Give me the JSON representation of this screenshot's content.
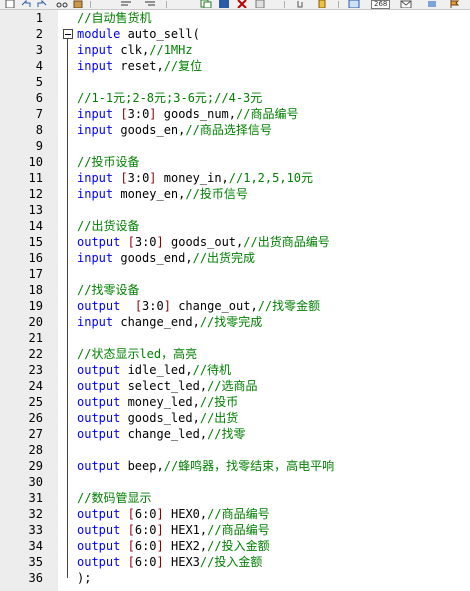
{
  "colors": {
    "keyword": "#0000ff",
    "comment": "#008000",
    "text": "#000000",
    "bracket": "#8b0000",
    "gutter": "#ededed"
  },
  "toolbar": {
    "icons": [
      "new-file",
      "undo",
      "redo",
      "cut",
      "paste",
      "clear",
      "copy",
      "link",
      "bookmark",
      "window",
      "mail"
    ],
    "badge": "268"
  },
  "lines": [
    {
      "n": "1",
      "tokens": [
        [
          "cm",
          "//自动售货机"
        ]
      ]
    },
    {
      "n": "2",
      "fold": true,
      "tokens": [
        [
          "kw",
          "module"
        ],
        [
          "txt",
          " auto_sell("
        ]
      ]
    },
    {
      "n": "3",
      "tokens": [
        [
          "kw",
          "input"
        ],
        [
          "txt",
          " clk,"
        ],
        [
          "cm",
          "//1MHz"
        ]
      ]
    },
    {
      "n": "4",
      "tokens": [
        [
          "kw",
          "input"
        ],
        [
          "txt",
          " reset,"
        ],
        [
          "cm",
          "//复位"
        ]
      ]
    },
    {
      "n": "5",
      "tokens": []
    },
    {
      "n": "6",
      "tokens": [
        [
          "cm",
          "//1-1元;2-8元;3-6元;//4-3元"
        ]
      ]
    },
    {
      "n": "7",
      "tokens": [
        [
          "kw",
          "input"
        ],
        [
          "txt",
          " "
        ],
        [
          "br",
          "["
        ],
        [
          "num",
          "3"
        ],
        [
          "txt",
          ":"
        ],
        [
          "num",
          "0"
        ],
        [
          "br",
          "]"
        ],
        [
          "txt",
          " goods_num,"
        ],
        [
          "cm",
          "//商品编号"
        ]
      ]
    },
    {
      "n": "8",
      "tokens": [
        [
          "kw",
          "input"
        ],
        [
          "txt",
          " goods_en,"
        ],
        [
          "cm",
          "//商品选择信号"
        ]
      ]
    },
    {
      "n": "9",
      "tokens": []
    },
    {
      "n": "10",
      "tokens": [
        [
          "cm",
          "//投币设备"
        ]
      ]
    },
    {
      "n": "11",
      "tokens": [
        [
          "kw",
          "input"
        ],
        [
          "txt",
          " "
        ],
        [
          "br",
          "["
        ],
        [
          "num",
          "3"
        ],
        [
          "txt",
          ":"
        ],
        [
          "num",
          "0"
        ],
        [
          "br",
          "]"
        ],
        [
          "txt",
          " money_in,"
        ],
        [
          "cm",
          "//1,2,5,10元"
        ]
      ]
    },
    {
      "n": "12",
      "tokens": [
        [
          "kw",
          "input"
        ],
        [
          "txt",
          " money_en,"
        ],
        [
          "cm",
          "//投币信号"
        ]
      ]
    },
    {
      "n": "13",
      "tokens": []
    },
    {
      "n": "14",
      "tokens": [
        [
          "cm",
          "//出货设备"
        ]
      ]
    },
    {
      "n": "15",
      "tokens": [
        [
          "kw",
          "output"
        ],
        [
          "txt",
          " "
        ],
        [
          "br",
          "["
        ],
        [
          "num",
          "3"
        ],
        [
          "txt",
          ":"
        ],
        [
          "num",
          "0"
        ],
        [
          "br",
          "]"
        ],
        [
          "txt",
          " goods_out,"
        ],
        [
          "cm",
          "//出货商品编号"
        ]
      ]
    },
    {
      "n": "16",
      "tokens": [
        [
          "kw",
          "input"
        ],
        [
          "txt",
          " goods_end,"
        ],
        [
          "cm",
          "//出货完成"
        ]
      ]
    },
    {
      "n": "17",
      "tokens": []
    },
    {
      "n": "18",
      "tokens": [
        [
          "cm",
          "//找零设备"
        ]
      ]
    },
    {
      "n": "19",
      "tokens": [
        [
          "kw",
          "output"
        ],
        [
          "txt",
          "  "
        ],
        [
          "br",
          "["
        ],
        [
          "num",
          "3"
        ],
        [
          "txt",
          ":"
        ],
        [
          "num",
          "0"
        ],
        [
          "br",
          "]"
        ],
        [
          "txt",
          " change_out,"
        ],
        [
          "cm",
          "//找零金额"
        ]
      ]
    },
    {
      "n": "20",
      "tokens": [
        [
          "kw",
          "input"
        ],
        [
          "txt",
          " change_end,"
        ],
        [
          "cm",
          "//找零完成"
        ]
      ]
    },
    {
      "n": "21",
      "tokens": []
    },
    {
      "n": "22",
      "tokens": [
        [
          "cm",
          "//状态显示led，高亮"
        ]
      ]
    },
    {
      "n": "23",
      "tokens": [
        [
          "kw",
          "output"
        ],
        [
          "txt",
          " idle_led,"
        ],
        [
          "cm",
          "//待机"
        ]
      ]
    },
    {
      "n": "24",
      "tokens": [
        [
          "kw",
          "output"
        ],
        [
          "txt",
          " select_led,"
        ],
        [
          "cm",
          "//选商品"
        ]
      ]
    },
    {
      "n": "25",
      "tokens": [
        [
          "kw",
          "output"
        ],
        [
          "txt",
          " money_led,"
        ],
        [
          "cm",
          "//投币"
        ]
      ]
    },
    {
      "n": "26",
      "tokens": [
        [
          "kw",
          "output"
        ],
        [
          "txt",
          " goods_led,"
        ],
        [
          "cm",
          "//出货"
        ]
      ]
    },
    {
      "n": "27",
      "tokens": [
        [
          "kw",
          "output"
        ],
        [
          "txt",
          " change_led,"
        ],
        [
          "cm",
          "//找零"
        ]
      ]
    },
    {
      "n": "28",
      "tokens": []
    },
    {
      "n": "29",
      "tokens": [
        [
          "kw",
          "output"
        ],
        [
          "txt",
          " beep,"
        ],
        [
          "cm",
          "//蜂鸣器，找零结束，高电平响"
        ]
      ]
    },
    {
      "n": "30",
      "tokens": []
    },
    {
      "n": "31",
      "tokens": [
        [
          "cm",
          "//数码管显示"
        ]
      ]
    },
    {
      "n": "32",
      "tokens": [
        [
          "kw",
          "output"
        ],
        [
          "txt",
          " "
        ],
        [
          "br",
          "["
        ],
        [
          "num",
          "6"
        ],
        [
          "txt",
          ":"
        ],
        [
          "num",
          "0"
        ],
        [
          "br",
          "]"
        ],
        [
          "txt",
          " HEX0,"
        ],
        [
          "cm",
          "//商品编号"
        ]
      ]
    },
    {
      "n": "33",
      "tokens": [
        [
          "kw",
          "output"
        ],
        [
          "txt",
          " "
        ],
        [
          "br",
          "["
        ],
        [
          "num",
          "6"
        ],
        [
          "txt",
          ":"
        ],
        [
          "num",
          "0"
        ],
        [
          "br",
          "]"
        ],
        [
          "txt",
          " HEX1,"
        ],
        [
          "cm",
          "//商品编号"
        ]
      ]
    },
    {
      "n": "34",
      "tokens": [
        [
          "kw",
          "output"
        ],
        [
          "txt",
          " "
        ],
        [
          "br",
          "["
        ],
        [
          "num",
          "6"
        ],
        [
          "txt",
          ":"
        ],
        [
          "num",
          "0"
        ],
        [
          "br",
          "]"
        ],
        [
          "txt",
          " HEX2,"
        ],
        [
          "cm",
          "//投入金额"
        ]
      ]
    },
    {
      "n": "35",
      "tokens": [
        [
          "kw",
          "output"
        ],
        [
          "txt",
          " "
        ],
        [
          "br",
          "["
        ],
        [
          "num",
          "6"
        ],
        [
          "txt",
          ":"
        ],
        [
          "num",
          "0"
        ],
        [
          "br",
          "]"
        ],
        [
          "txt",
          " HEX3"
        ],
        [
          "cm",
          "//投入金额"
        ]
      ]
    },
    {
      "n": "36",
      "tokens": [
        [
          "txt",
          ");"
        ]
      ]
    }
  ]
}
